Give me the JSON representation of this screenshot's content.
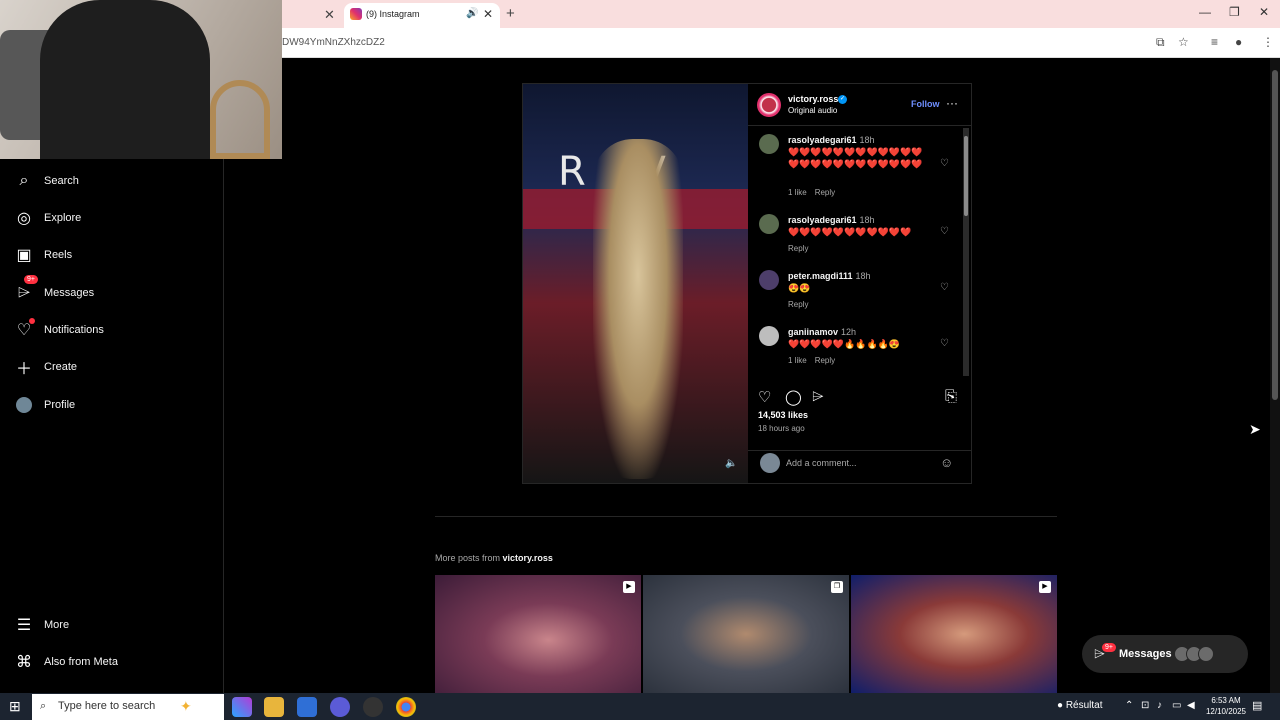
{
  "browser": {
    "active_tab_title": "(9) Instagram",
    "url": "DW94YmNnZXhzcDZ2",
    "new_tab": "+",
    "close_tab": "✕",
    "win_min": "—",
    "win_max": "❐",
    "win_close": "✕"
  },
  "sidebar": {
    "items": [
      {
        "label": "Search",
        "icon": "search-icon"
      },
      {
        "label": "Explore",
        "icon": "compass-icon"
      },
      {
        "label": "Reels",
        "icon": "reels-icon"
      },
      {
        "label": "Messages",
        "icon": "messenger-icon",
        "badge": "9+"
      },
      {
        "label": "Notifications",
        "icon": "heart-icon"
      },
      {
        "label": "Create",
        "icon": "plus-icon"
      },
      {
        "label": "Profile",
        "icon": "avatar-icon"
      },
      {
        "label": "More",
        "icon": "menu-icon"
      },
      {
        "label": "Also from Meta",
        "icon": "meta-icon"
      }
    ]
  },
  "post": {
    "author": "victory.ross",
    "audio": "Original audio",
    "follow": "Follow",
    "likes": "14,503 likes",
    "posted": "18 hours ago",
    "comment_placeholder": "Add a comment..."
  },
  "comments": [
    {
      "user": "rasolyadegari61",
      "time": "18h",
      "text": "❤️❤️❤️❤️❤️❤️❤️❤️❤️❤️❤️❤️❤️❤️❤️❤️❤️❤️❤️❤️❤️❤️❤️❤️",
      "likes": "1 like",
      "reply": "Reply"
    },
    {
      "user": "rasolyadegari61",
      "time": "18h",
      "text": "❤️❤️❤️❤️❤️❤️❤️❤️❤️❤️❤️",
      "likes": "",
      "reply": "Reply"
    },
    {
      "user": "peter.magdi111",
      "time": "18h",
      "text": "😍😍",
      "likes": "",
      "reply": "Reply"
    },
    {
      "user": "ganiinamov",
      "time": "12h",
      "text": "❤️❤️❤️❤️❤️🔥🔥🔥🔥😍",
      "likes": "1 like",
      "reply": "Reply"
    }
  ],
  "more_posts": {
    "prefix": "More posts from ",
    "author": "victory.ross"
  },
  "messages_button": {
    "label": "Messages",
    "badge": "9+"
  },
  "taskbar": {
    "search_placeholder": "Type here to search",
    "weather": "Résultat",
    "time": "6:53 AM",
    "date": "12/10/2025"
  }
}
